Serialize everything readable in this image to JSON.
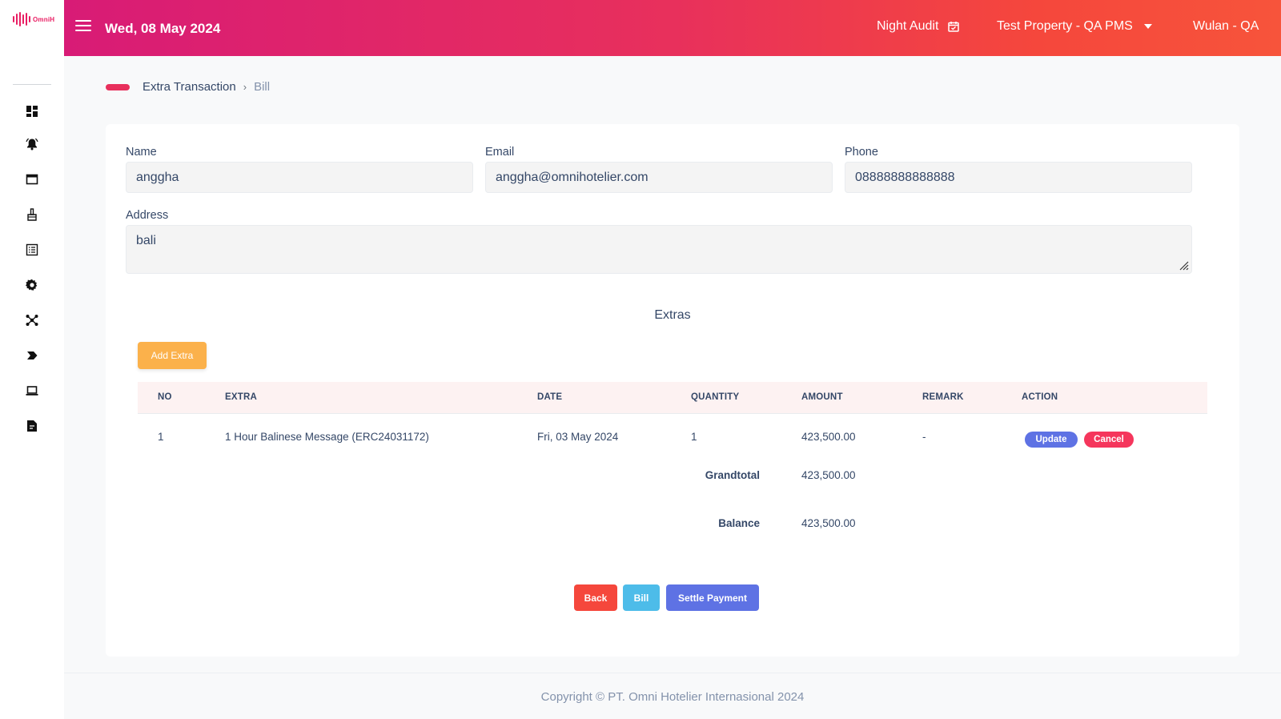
{
  "app": {
    "logo_text": "OmniH"
  },
  "header": {
    "date": "Wed, 08 May 2024",
    "night_audit": "Night Audit",
    "property": "Test Property - QA PMS",
    "user": "Wulan - QA"
  },
  "sidebar": {
    "icons": [
      "dashboard-icon",
      "bell-icon",
      "window-icon",
      "cleaning-icon",
      "list-icon",
      "settings-icon",
      "integration-icon",
      "tag-icon",
      "laptop-icon",
      "report-icon"
    ]
  },
  "breadcrumb": {
    "parent": "Extra Transaction",
    "current": "Bill"
  },
  "form": {
    "name_label": "Name",
    "name_value": "anggha",
    "email_label": "Email",
    "email_value": "anggha@omnihotelier.com",
    "phone_label": "Phone",
    "phone_value": "08888888888888",
    "address_label": "Address",
    "address_value": "bali"
  },
  "extras": {
    "title": "Extras",
    "add_label": "Add Extra",
    "columns": [
      "NO",
      "EXTRA",
      "DATE",
      "QUANTITY",
      "AMOUNT",
      "REMARK",
      "ACTION"
    ],
    "rows": [
      {
        "no": "1",
        "extra": "1 Hour Balinese Message (ERC24031172)",
        "date": "Fri, 03 May 2024",
        "quantity": "1",
        "amount": "423,500.00",
        "remark": "-",
        "update_label": "Update",
        "cancel_label": "Cancel"
      }
    ],
    "grandtotal_label": "Grandtotal",
    "grandtotal_value": "423,500.00",
    "balance_label": "Balance",
    "balance_value": "423,500.00"
  },
  "actions": {
    "back": "Back",
    "bill": "Bill",
    "settle": "Settle Payment"
  },
  "footer": {
    "copyright": "Copyright © PT. Omni Hotelier Internasional 2024"
  },
  "colors": {
    "accent": "#e8305c",
    "primary": "#5e72e4",
    "warning": "#fbb14b",
    "info": "#4dbce9",
    "danger": "#f5365c"
  }
}
